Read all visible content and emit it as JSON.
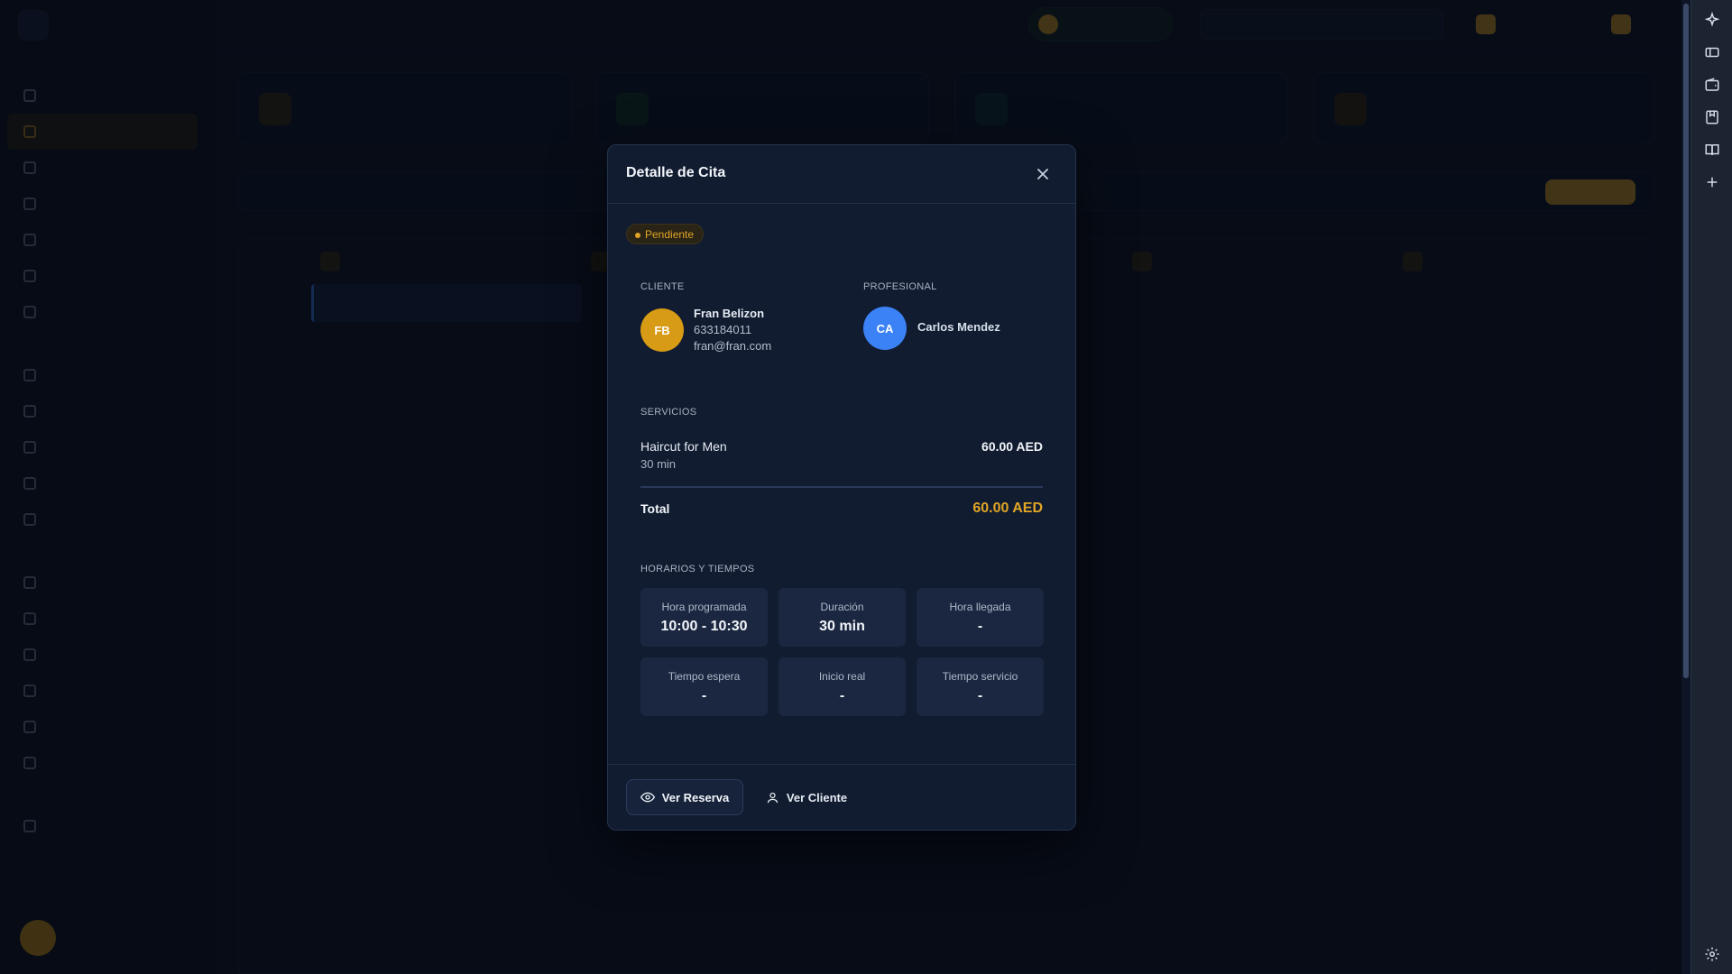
{
  "modal": {
    "title": "Detalle de Cita",
    "status": "Pendiente",
    "client_label": "CLIENTE",
    "client": {
      "initials": "FB",
      "name": "Fran Belizon",
      "phone": "633184011",
      "email": "fran@fran.com"
    },
    "professional_label": "PROFESIONAL",
    "professional": {
      "initials": "CA",
      "name": "Carlos Mendez"
    },
    "services_label": "SERVICIOS",
    "services": [
      {
        "name": "Haircut for Men",
        "duration": "30 min",
        "price": "60.00 AED"
      }
    ],
    "total_label": "Total",
    "total_value": "60.00 AED",
    "times_label": "HORARIOS Y TIEMPOS",
    "times": [
      {
        "label": "Hora programada",
        "value": "10:00 - 10:30"
      },
      {
        "label": "Duración",
        "value": "30 min"
      },
      {
        "label": "Hora llegada",
        "value": "-"
      },
      {
        "label": "Tiempo espera",
        "value": "-"
      },
      {
        "label": "Inicio real",
        "value": "-"
      },
      {
        "label": "Tiempo servicio",
        "value": "-"
      }
    ],
    "footer": {
      "view_booking": "Ver Reserva",
      "view_client": "Ver Cliente"
    }
  },
  "colors": {
    "accent": "#e0a526",
    "client_avatar": "#d89b16",
    "professional_avatar": "#3b82f6",
    "modal_bg": "#111c30"
  },
  "icons": {
    "close": "close-icon",
    "view_booking": "eye-icon",
    "view_client": "user-icon",
    "rail": [
      "sparkle-icon",
      "ticket-icon",
      "wallet-icon",
      "bookmark-icon",
      "book-icon",
      "plus-icon",
      "gear-icon"
    ]
  }
}
